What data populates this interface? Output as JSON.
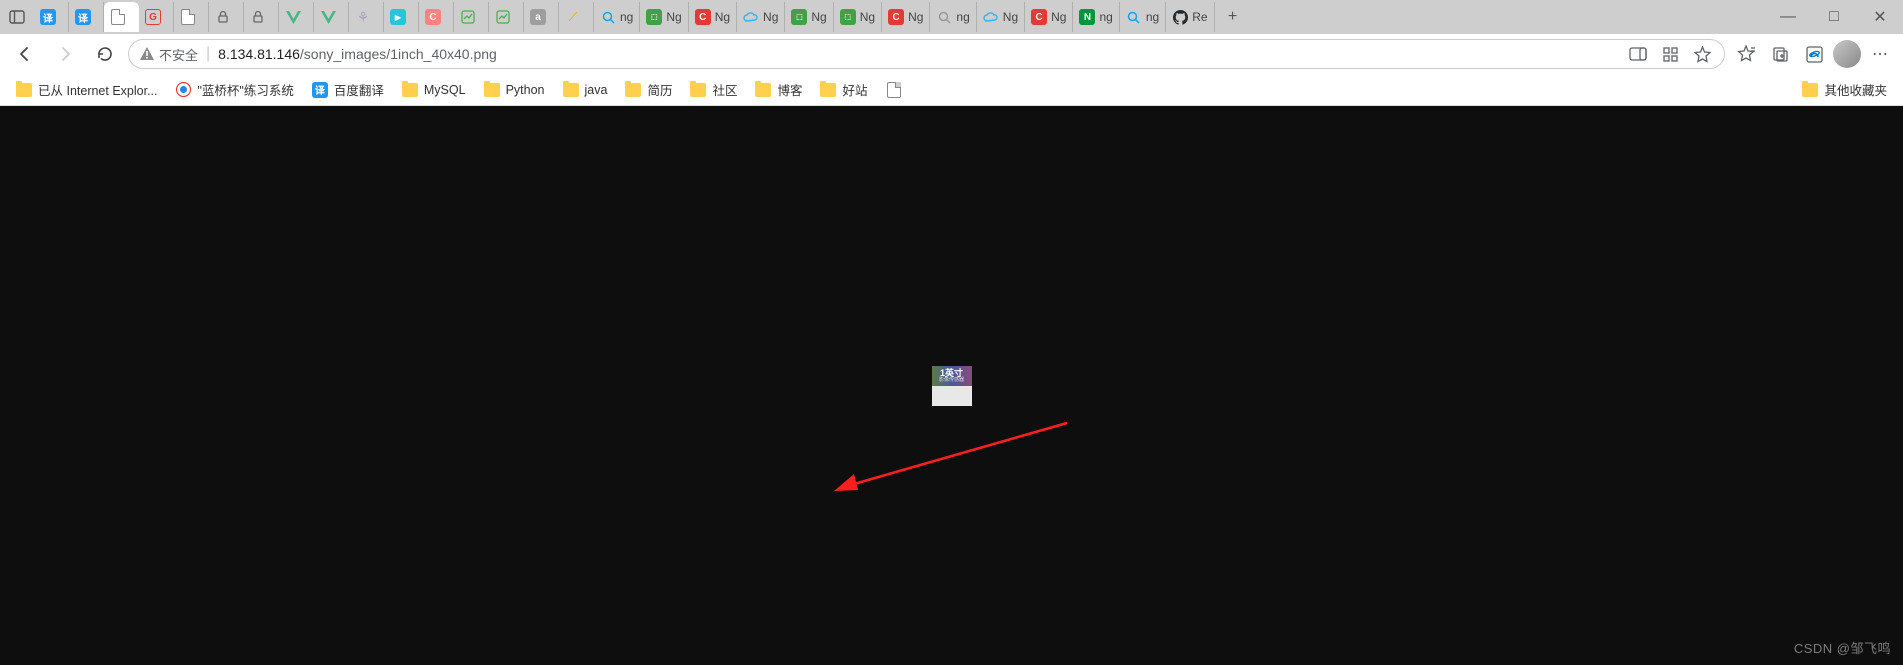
{
  "browser": {
    "security_label": "不安全",
    "url_host": "8.134.81.146",
    "url_path": "/sony_images/1inch_40x40.png",
    "tabs": [
      {
        "icon": "panel",
        "label": ""
      },
      {
        "icon": "translate-blue",
        "label": "译"
      },
      {
        "icon": "translate-blue",
        "label": "译"
      },
      {
        "icon": "page",
        "label": "",
        "active": true
      },
      {
        "icon": "g-red",
        "label": ""
      },
      {
        "icon": "page",
        "label": ""
      },
      {
        "icon": "lock",
        "label": ""
      },
      {
        "icon": "lock",
        "label": ""
      },
      {
        "icon": "vue",
        "label": ""
      },
      {
        "icon": "vue",
        "label": ""
      },
      {
        "icon": "paw",
        "label": ""
      },
      {
        "icon": "bili",
        "label": ""
      },
      {
        "icon": "c-pink",
        "label": ""
      },
      {
        "icon": "chart",
        "label": ""
      },
      {
        "icon": "chart",
        "label": ""
      },
      {
        "icon": "a-grey",
        "label": ""
      },
      {
        "icon": "wave",
        "label": ""
      },
      {
        "icon": "search",
        "label": "ng"
      },
      {
        "icon": "box-green",
        "label": "Ng"
      },
      {
        "icon": "c-red",
        "label": "Ng"
      },
      {
        "icon": "cloud",
        "label": "Ng"
      },
      {
        "icon": "box-green",
        "label": "Ng"
      },
      {
        "icon": "box-green",
        "label": "Ng"
      },
      {
        "icon": "c-red",
        "label": "Ng"
      },
      {
        "icon": "search",
        "label": "ng"
      },
      {
        "icon": "cloud",
        "label": "Ng"
      },
      {
        "icon": "c-red",
        "label": "Ng"
      },
      {
        "icon": "nginx",
        "label": "ng"
      },
      {
        "icon": "search",
        "label": "ng"
      },
      {
        "icon": "github",
        "label": "Re"
      }
    ],
    "newtab": "+"
  },
  "bookmarks": {
    "items": [
      {
        "type": "folder",
        "label": "已从 Internet Explor..."
      },
      {
        "type": "icon-lanqiao",
        "label": "\"蓝桥杯\"练习系统"
      },
      {
        "type": "icon-translate",
        "label": "百度翻译"
      },
      {
        "type": "folder",
        "label": "MySQL"
      },
      {
        "type": "folder",
        "label": "Python"
      },
      {
        "type": "folder",
        "label": "java"
      },
      {
        "type": "folder",
        "label": "简历"
      },
      {
        "type": "folder",
        "label": "社区"
      },
      {
        "type": "folder",
        "label": "博客"
      },
      {
        "type": "folder",
        "label": "好站"
      },
      {
        "type": "page",
        "label": ""
      }
    ],
    "other": "其他收藏夹"
  },
  "image": {
    "line1": "1英寸",
    "line2": "影像传感器"
  },
  "watermark": "CSDN @邹飞鸣",
  "win": {
    "min": "—",
    "max": "□",
    "close": "✕"
  }
}
